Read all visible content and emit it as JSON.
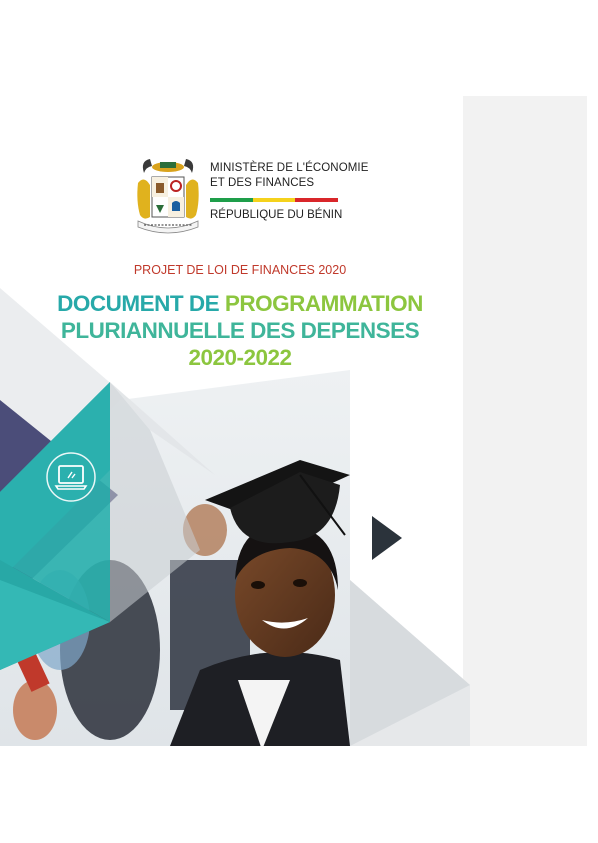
{
  "header": {
    "ministry_line1": "MINISTÈRE DE L'ÉCONOMIE",
    "ministry_line2": "ET DES FINANCES",
    "republic": "RÉPUBLIQUE DU BÉNIN",
    "stripe_colors": [
      "#1e9e4a",
      "#f5d21c",
      "#d9262a"
    ],
    "coat_of_arms_motto": "FRATERNITÉ JUSTICE TRAVAIL"
  },
  "cover": {
    "subtitle": "PROJET DE LOI DE FINANCES 2020",
    "title_line1_part1": "DOCUMENT DE ",
    "title_line1_part2": "PROGRAMMATION",
    "title_line2": "PLURIANNUELLE DES DEPENSES",
    "title_line3": "2020-2022"
  },
  "decor": {
    "icon": "laptop-icon",
    "arrow": "play-arrow",
    "photo": "graduate-photo"
  },
  "colors": {
    "teal": "#2bb0ae",
    "green": "#8cc63f",
    "red": "#c0392b",
    "dark": "#2b333b"
  }
}
